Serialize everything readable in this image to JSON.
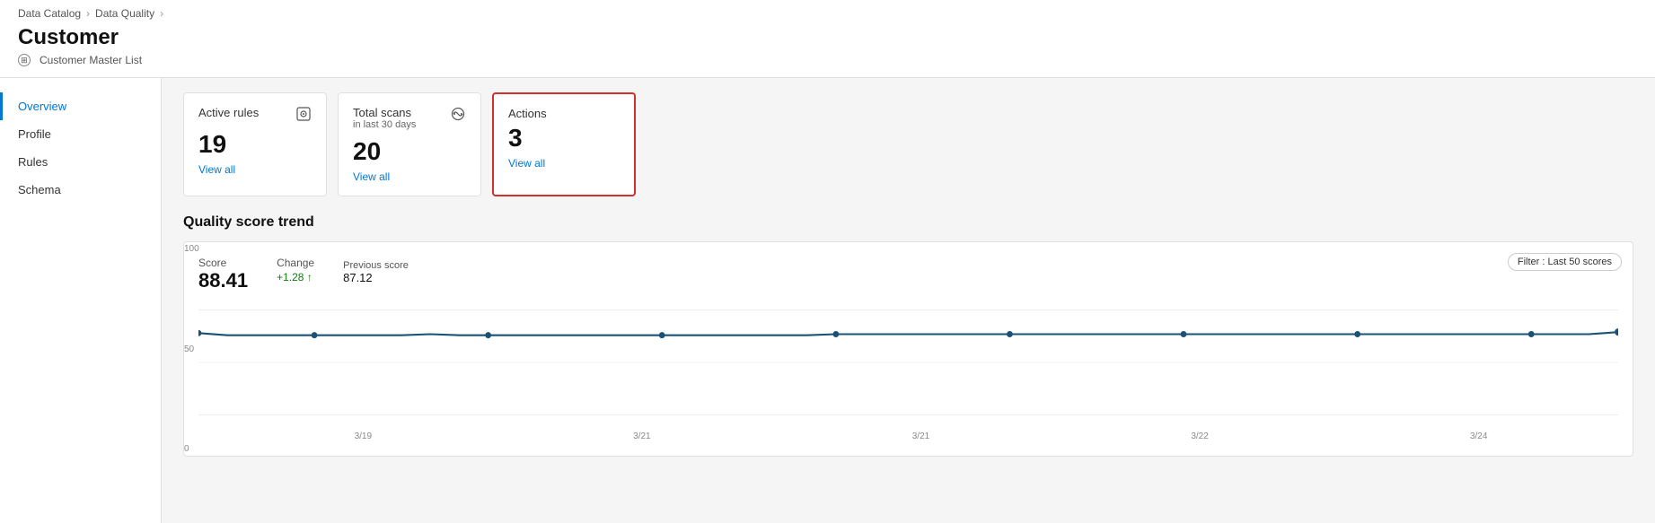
{
  "breadcrumb": {
    "items": [
      "Data Catalog",
      "Data Quality"
    ]
  },
  "page": {
    "title": "Customer",
    "subtitle": "Customer Master List"
  },
  "sidebar": {
    "items": [
      {
        "label": "Overview",
        "active": true
      },
      {
        "label": "Profile",
        "active": false
      },
      {
        "label": "Rules",
        "active": false
      },
      {
        "label": "Schema",
        "active": false
      }
    ]
  },
  "cards": [
    {
      "title": "Active rules",
      "subtitle": "",
      "value": "19",
      "link": "View all",
      "highlighted": false,
      "icon": "rules-icon"
    },
    {
      "title": "Total scans",
      "subtitle": "in last 30 days",
      "value": "20",
      "link": "View all",
      "highlighted": false,
      "icon": "scan-icon"
    },
    {
      "title": "Actions",
      "subtitle": "",
      "value": "3",
      "link": "View all",
      "highlighted": true,
      "icon": ""
    }
  ],
  "chart": {
    "section_title": "Quality score trend",
    "score_label": "Score",
    "score_value": "88.41",
    "change_label": "Change",
    "change_value": "+1.28 ↑",
    "prev_label": "Previous score",
    "prev_value": "87.12",
    "filter_label": "Filter : Last 50 scores",
    "y_axis": [
      "100",
      "50",
      "0"
    ],
    "x_axis": [
      "3/19",
      "3/21",
      "3/21",
      "3/22",
      "3/24"
    ],
    "data_points": [
      78,
      76,
      76,
      76,
      75,
      76,
      76,
      76,
      77,
      76,
      76,
      76,
      76,
      76,
      76,
      76,
      76,
      76,
      76,
      76,
      76,
      76,
      77,
      77,
      77,
      77,
      77,
      77,
      77,
      77,
      77,
      77,
      77,
      77,
      77,
      77,
      77,
      77,
      77,
      77,
      77,
      77,
      77,
      77,
      77,
      77,
      77,
      77,
      77,
      79
    ]
  }
}
